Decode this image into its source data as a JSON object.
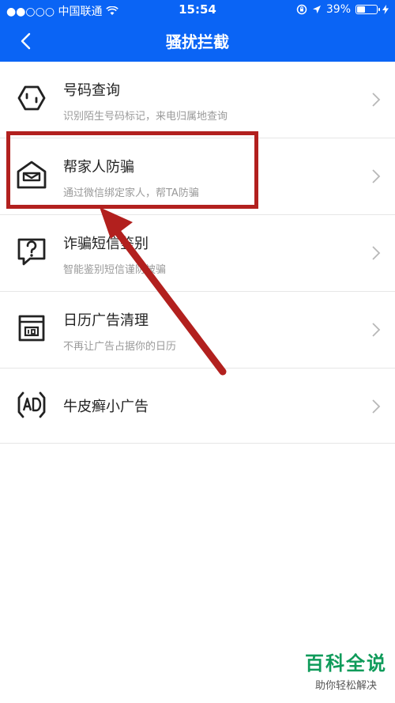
{
  "status_bar": {
    "carrier": "●●○○○ 中国联通",
    "time": "15:54",
    "battery": "39%",
    "battery_level": 0.39
  },
  "nav": {
    "back_icon": "chevron-left-icon",
    "title": "骚扰拦截"
  },
  "items": [
    {
      "label": "号码查询",
      "sub": "识别陌生号码标记，来电归属地查询",
      "icon": "search-number-icon"
    },
    {
      "label": "帮家人防骗",
      "sub": "通过微信绑定家人，帮TA防骗",
      "icon": "home-envelope-icon"
    },
    {
      "label": "诈骗短信鉴别",
      "sub": "智能鉴别短信谨防被骗",
      "icon": "question-message-icon"
    },
    {
      "label": "日历广告清理",
      "sub": "不再让广告占据你的日历",
      "icon": "calendar-icon"
    },
    {
      "label": "牛皮癣小广告",
      "icon": "ad-icon"
    }
  ],
  "watermark": {
    "title": "百科全说",
    "sub": "助你轻松解决"
  },
  "colors": {
    "brand_blue": "#0a64f5",
    "annotation_red": "#b2201e",
    "watermark_green": "#0f9b5a"
  }
}
